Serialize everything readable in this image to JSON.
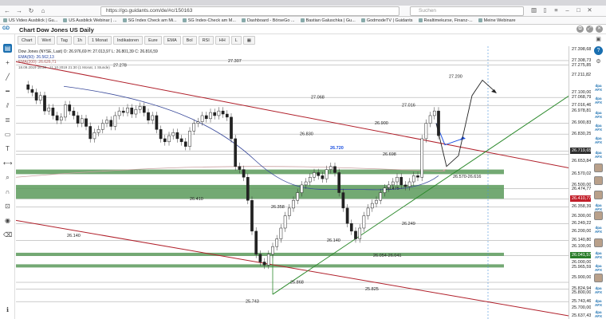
{
  "browser": {
    "url": "https://go.guidants.com/de/#c/150163",
    "search_placeholder": "Suchen",
    "bookmarks": [
      "US Video Ausblick | Gu...",
      "US Ausblick Webinar | ...",
      "SG Index Check am Mi...",
      "SG Index-Check am M...",
      "Dashboard - BörseGo ...",
      "Bastian Galuschka | Gu...",
      "GodmodeTV | Guidants",
      "Realtimekurse, Finanz-...",
      "Meine Webinare"
    ]
  },
  "app": {
    "logo": "GD",
    "title": "Chart Dow Jones US Daily"
  },
  "toolbar": {
    "items": [
      "Chart",
      "Wert",
      "Tag",
      "1h",
      "1 Monat",
      "Indikatoren",
      "Eure",
      "EMA",
      "Bol",
      "RSI",
      "HH",
      "L",
      "▦"
    ]
  },
  "legend": {
    "symbol_line": "Dow Jones (NYSE, Last) O: 26.976,69  H: 27.013,97  L: 26.801,39  C: 26.816,59",
    "ema50": "EMA(50): 26.562,13",
    "ema200": "EMA(200): 26.626,71",
    "range_line": "18.09.2019 16:30 - 11.10.2019 21:30  (1 Monat, 1 Stunde)"
  },
  "annotations": [
    {
      "text": "27.307"
    },
    {
      "text": "27.278"
    },
    {
      "text": "27.068"
    },
    {
      "text": "27.016"
    },
    {
      "text": "27.200"
    },
    {
      "text": "26.900"
    },
    {
      "text": "26.830"
    },
    {
      "text": "26.720"
    },
    {
      "text": "26.698"
    },
    {
      "text": "26.475"
    },
    {
      "text": "26.570-26.616"
    },
    {
      "text": "26.410"
    },
    {
      "text": "26.358"
    },
    {
      "text": "26.249"
    },
    {
      "text": "26.140"
    },
    {
      "text": "26.140"
    },
    {
      "text": "26.054-26.041"
    },
    {
      "text": "25.868"
    },
    {
      "text": "25.825"
    },
    {
      "text": "25.743"
    }
  ],
  "price_axis": [
    {
      "value": "27.398,68",
      "style": "plain"
    },
    {
      "value": "27.308,73",
      "style": "plain"
    },
    {
      "value": "27.275,85",
      "style": "plain"
    },
    {
      "value": "27.211,82",
      "style": "plain"
    },
    {
      "value": "27.100,00",
      "style": "plain"
    },
    {
      "value": "27.068,79",
      "style": "plain"
    },
    {
      "value": "27.016,46",
      "style": "plain"
    },
    {
      "value": "26.978,81",
      "style": "plain"
    },
    {
      "value": "26.900,83",
      "style": "plain"
    },
    {
      "value": "26.830,25",
      "style": "plain"
    },
    {
      "value": "26.719,65",
      "style": "dark"
    },
    {
      "value": "26.653,84",
      "style": "plain"
    },
    {
      "value": "26.570,02",
      "style": "plain"
    },
    {
      "value": "26.500,00",
      "style": "plain"
    },
    {
      "value": "26.474,77",
      "style": "plain"
    },
    {
      "value": "26.410,77",
      "style": "red"
    },
    {
      "value": "26.358,39",
      "style": "plain"
    },
    {
      "value": "26.300,00",
      "style": "plain"
    },
    {
      "value": "26.249,22",
      "style": "plain"
    },
    {
      "value": "26.200,00",
      "style": "plain"
    },
    {
      "value": "26.140,80",
      "style": "plain"
    },
    {
      "value": "26.100,00",
      "style": "plain"
    },
    {
      "value": "26.041,57",
      "style": "green"
    },
    {
      "value": "26.000,00",
      "style": "plain"
    },
    {
      "value": "25.965,59",
      "style": "plain"
    },
    {
      "value": "25.900,00",
      "style": "plain"
    },
    {
      "value": "25.824,94",
      "style": "plain"
    },
    {
      "value": "25.800,00",
      "style": "plain"
    },
    {
      "value": "25.743,46",
      "style": "plain"
    },
    {
      "value": "25.700,00",
      "style": "plain"
    },
    {
      "value": "25.637,43",
      "style": "plain"
    }
  ],
  "right_panel": {
    "help": "?",
    "dpa_label": "dpa AFX"
  },
  "colors": {
    "accent": "#1a6fb0",
    "resistance": "#b01f2a",
    "trendline": "#2e8b2e",
    "zone": "#5a9a5a",
    "projection_blue": "#1b4fe0"
  }
}
